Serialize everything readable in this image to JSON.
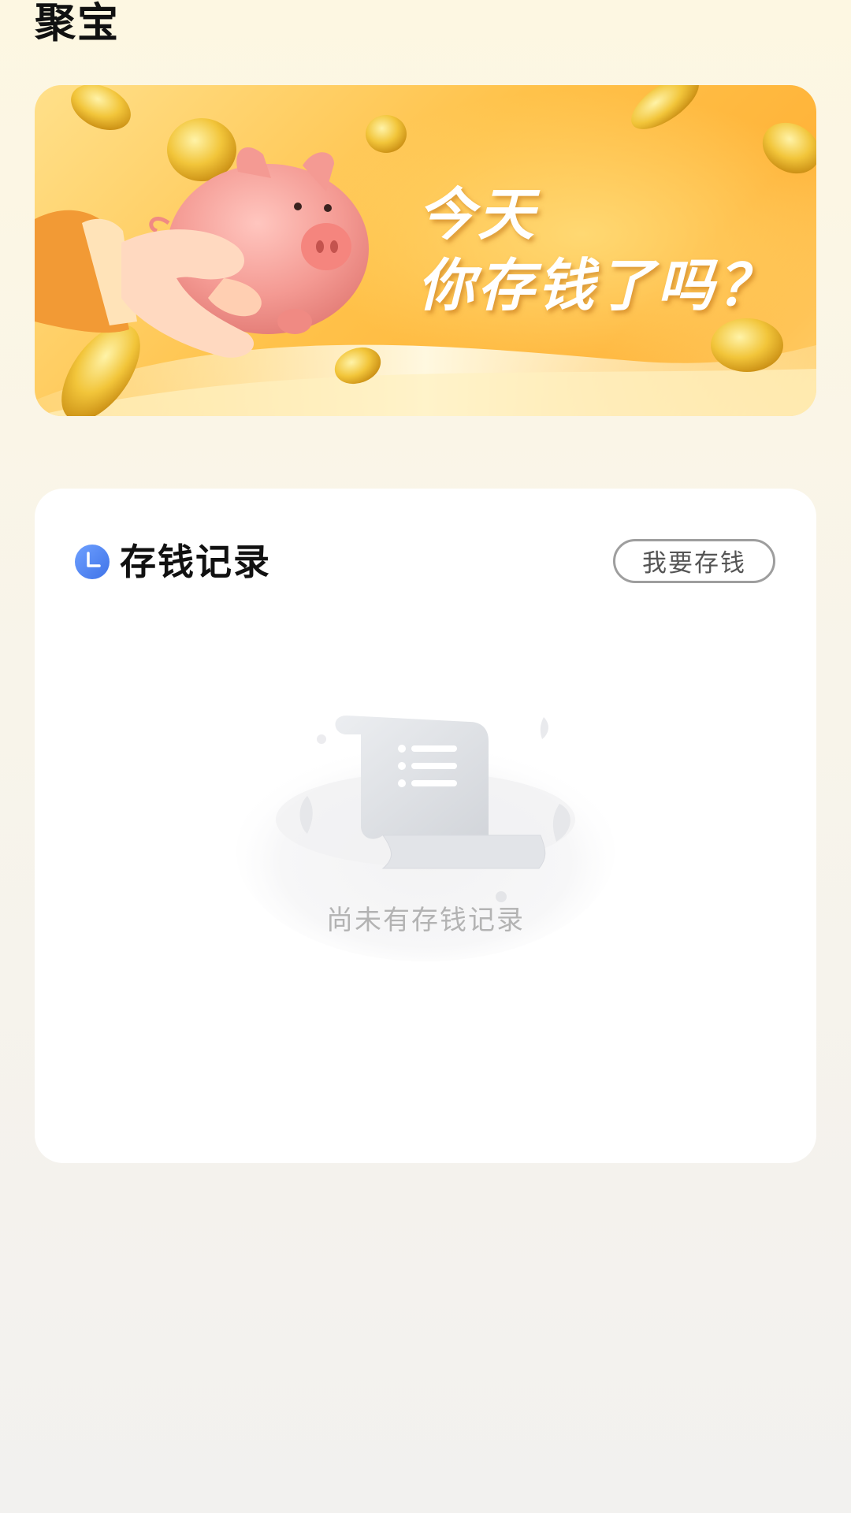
{
  "page": {
    "title": "聚宝"
  },
  "banner": {
    "line1": "今天",
    "line2": "你存钱了吗？"
  },
  "records": {
    "title": "存钱记录",
    "save_button_label": "我要存钱",
    "empty_text": "尚未有存钱记录"
  },
  "icons": {
    "clock": "clock-icon",
    "empty": "empty-receipt-icon",
    "piggy": "piggy-bank-icon",
    "coin": "coin-icon"
  },
  "colors": {
    "accent_blue": "#4d86f5",
    "banner_yellow": "#ffc24a",
    "piggy_pink": "#f49a93",
    "button_border": "#9e9e9e",
    "empty_text": "#b3b3b3"
  }
}
